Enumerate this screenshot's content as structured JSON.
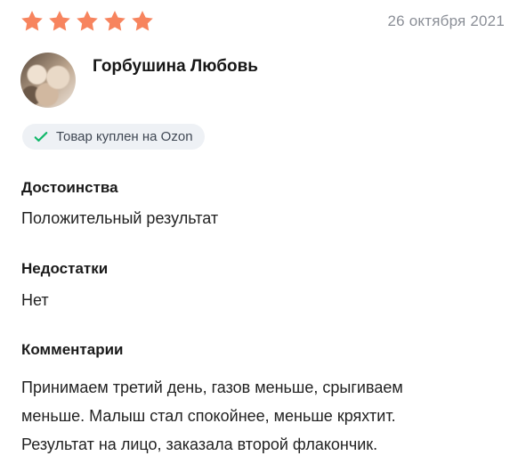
{
  "review": {
    "rating": 5,
    "max_rating": 5,
    "date": "26 октября 2021",
    "author": {
      "name": "Горбушина Любовь"
    },
    "badge": {
      "text": "Товар куплен на Ozon",
      "icon": "check-icon"
    },
    "sections": {
      "pros": {
        "title": "Достоинства",
        "text": "Положительный результат"
      },
      "cons": {
        "title": "Недостатки",
        "text": "Нет"
      },
      "comment": {
        "title": "Комментарии",
        "lines": [
          "Принимаем третий день, газов меньше, срыгиваем",
          "меньше. Малыш стал спокойнее, меньше кряхтит.",
          "Результат на лицо, заказала второй флакончик."
        ]
      }
    }
  },
  "colors": {
    "star": "#f7845e",
    "date": "#8b8f97",
    "badge_bg": "#eef1f5",
    "check": "#11b86a"
  }
}
